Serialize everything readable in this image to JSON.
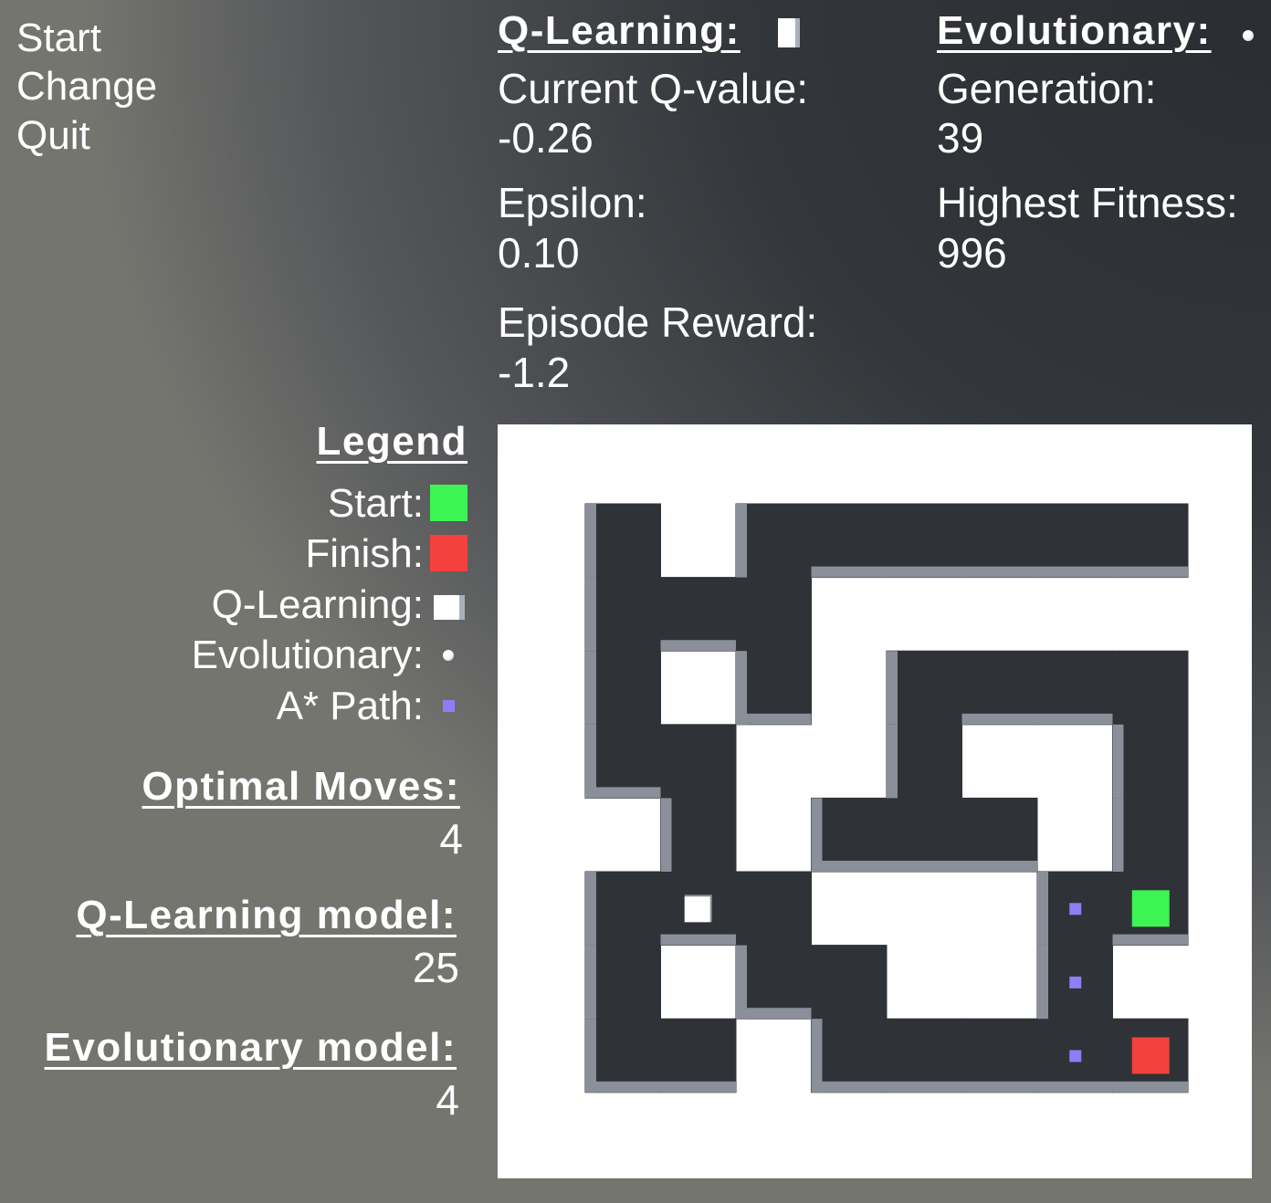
{
  "menu": {
    "start": "Start",
    "change": "Change",
    "quit": "Quit"
  },
  "qlearning": {
    "title": "Q-Learning:",
    "q_value_label": "Current Q-value:",
    "q_value": "-0.26",
    "epsilon_label": "Epsilon:",
    "epsilon": "0.10",
    "reward_label": "Episode Reward:",
    "reward": "-1.2"
  },
  "evolutionary": {
    "title": "Evolutionary:",
    "generation_label": "Generation:",
    "generation": "39",
    "fitness_label": "Highest Fitness:",
    "fitness": "996"
  },
  "legend": {
    "title": "Legend",
    "start": "Start:",
    "finish": "Finish:",
    "qlearning": "Q-Learning:",
    "evolutionary": "Evolutionary:",
    "astar": "A* Path:"
  },
  "results": {
    "optimal_label": "Optimal Moves:",
    "optimal": "4",
    "qmodel_label": "Q-Learning model:",
    "qmodel": "25",
    "evomodel_label": "Evolutionary model:",
    "evomodel": "4"
  },
  "colors": {
    "start": "#3df552",
    "finish": "#f5413d",
    "astar": "#8f7df7",
    "floor": "#2f3236",
    "wall": "#ffffff",
    "wall_side": "#8a8f99"
  },
  "icons": {
    "qlearning_agent": "white-cube-icon",
    "evolutionary_agent": "white-sphere-icon",
    "astar_marker": "purple-square-icon"
  },
  "maze": {
    "rows": 8,
    "cols": 8,
    "open_cells": [
      [
        0,
        0
      ],
      [
        0,
        2
      ],
      [
        0,
        3
      ],
      [
        0,
        4
      ],
      [
        0,
        5
      ],
      [
        0,
        6
      ],
      [
        0,
        7
      ],
      [
        1,
        0
      ],
      [
        1,
        1
      ],
      [
        1,
        2
      ],
      [
        2,
        0
      ],
      [
        2,
        2
      ],
      [
        2,
        4
      ],
      [
        2,
        5
      ],
      [
        2,
        6
      ],
      [
        2,
        7
      ],
      [
        3,
        0
      ],
      [
        3,
        1
      ],
      [
        3,
        4
      ],
      [
        3,
        7
      ],
      [
        4,
        1
      ],
      [
        4,
        3
      ],
      [
        4,
        4
      ],
      [
        4,
        5
      ],
      [
        4,
        7
      ],
      [
        5,
        0
      ],
      [
        5,
        1
      ],
      [
        5,
        2
      ],
      [
        5,
        6
      ],
      [
        5,
        7
      ],
      [
        6,
        0
      ],
      [
        6,
        2
      ],
      [
        6,
        3
      ],
      [
        6,
        6
      ],
      [
        7,
        0
      ],
      [
        7,
        1
      ],
      [
        7,
        3
      ],
      [
        7,
        4
      ],
      [
        7,
        5
      ],
      [
        7,
        6
      ],
      [
        7,
        7
      ]
    ],
    "start": [
      5,
      7
    ],
    "finish": [
      7,
      7
    ],
    "qlearning_agent": [
      5,
      1
    ],
    "astar_path": [
      [
        5,
        6
      ],
      [
        6,
        6
      ],
      [
        7,
        6
      ]
    ]
  }
}
